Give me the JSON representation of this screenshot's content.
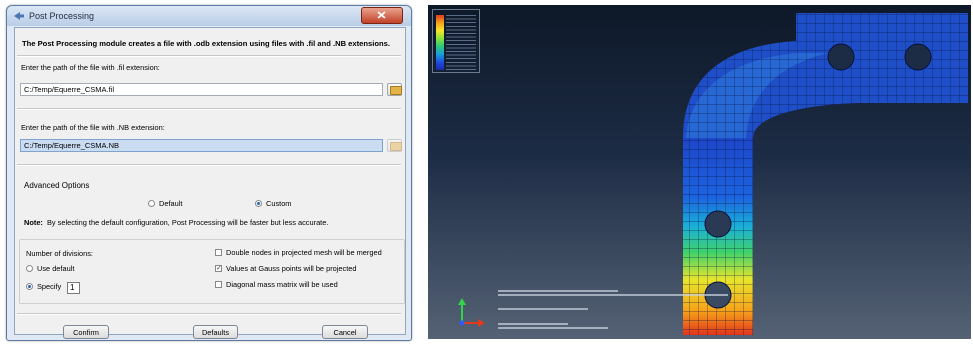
{
  "dialog": {
    "title": "Post Processing",
    "intro": "The Post Processing module creates a file with .odb extension using files with .fil and .NB extensions.",
    "fil": {
      "label": "Enter the path of the file with .fil extension:",
      "value": "C:/Temp/Equerre_CSMA.fil"
    },
    "nb": {
      "label": "Enter the path of the file with .NB extension:",
      "value": "C:/Temp/Equerre_CSMA.NB"
    },
    "advanced": {
      "title": "Advanced Options",
      "default_label": "Default",
      "custom_label": "Custom",
      "selected": "Custom"
    },
    "note": {
      "prefix": "Note:",
      "text": "By selecting the default configuration, Post Processing will be faster but less accurate."
    },
    "divisions": {
      "label": "Number of divisions:",
      "use_default_label": "Use default",
      "specify_label": "Specify",
      "specify_value": "1"
    },
    "options": [
      {
        "label": "Double nodes in projected mesh will be merged",
        "checked": false
      },
      {
        "label": "Values at Gauss points will be projected",
        "checked": true
      },
      {
        "label": "Diagonal mass matrix will be used",
        "checked": false
      }
    ],
    "buttons": {
      "confirm": "Confirm",
      "defaults": "Defaults",
      "cancel": "Cancel"
    }
  },
  "viewport": {
    "colors": {
      "mesh_main": "#1f4fc8",
      "hot": "#e23a1a",
      "background_top": "#0d1828"
    }
  }
}
